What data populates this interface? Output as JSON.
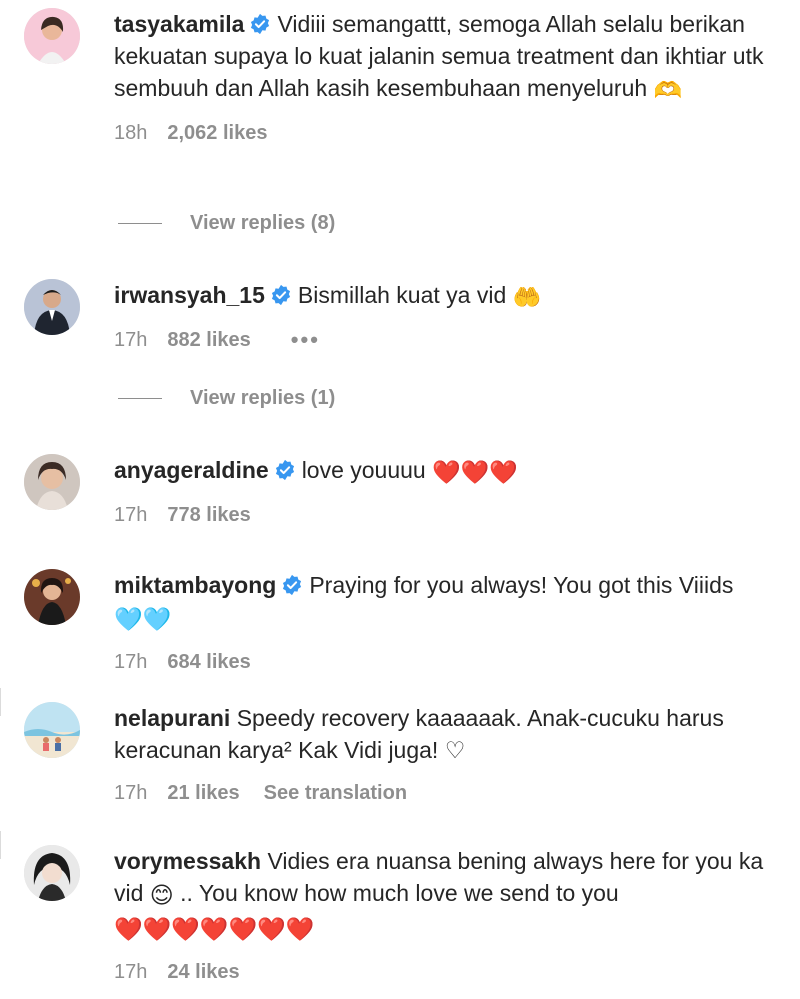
{
  "comments": [
    {
      "username": "tasyakamila",
      "verified": true,
      "text": "Vidiii semangattt, semoga Allah selalu berikan kekuatan supaya lo kuat jalanin semua treatment dan ikhtiar utk sembuuh dan Allah kasih kesembuhaan menyeluruh",
      "emoji": "🫶",
      "time": "18h",
      "likes": "2,062 likes",
      "replies": "View replies (8)"
    },
    {
      "username": "irwansyah_15",
      "verified": true,
      "text": "Bismillah kuat ya vid",
      "emoji": "🤲",
      "time": "17h",
      "likes": "882 likes",
      "more": "•••",
      "replies": "View replies (1)"
    },
    {
      "username": "anyageraldine",
      "verified": true,
      "text": "love youuuu",
      "emoji": "❤️❤️❤️",
      "time": "17h",
      "likes": "778 likes"
    },
    {
      "username": "miktambayong",
      "verified": true,
      "text": "Praying for you always! You got this Viiids",
      "emoji": "🩵🩵",
      "time": "17h",
      "likes": "684 likes"
    },
    {
      "username": "nelapurani",
      "verified": false,
      "text": "Speedy recovery kaaaaaak. Anak-cucuku harus keracunan karya² Kak Vidi juga! ♡",
      "time": "17h",
      "likes": "21 likes",
      "translation": "See translation"
    },
    {
      "username": "vorymessakh",
      "verified": false,
      "text_a": "Vidies era nuansa bening always here for you ka vid",
      "emoji_a": "😊",
      "text_b": ".. You know how much love we send to you",
      "emoji_b": "❤️❤️❤️❤️❤️❤️❤️",
      "time": "17h",
      "likes": "24 likes"
    }
  ],
  "colors": {
    "verified": "#3897f0",
    "meta": "#8e8e8e",
    "text": "#262626"
  }
}
